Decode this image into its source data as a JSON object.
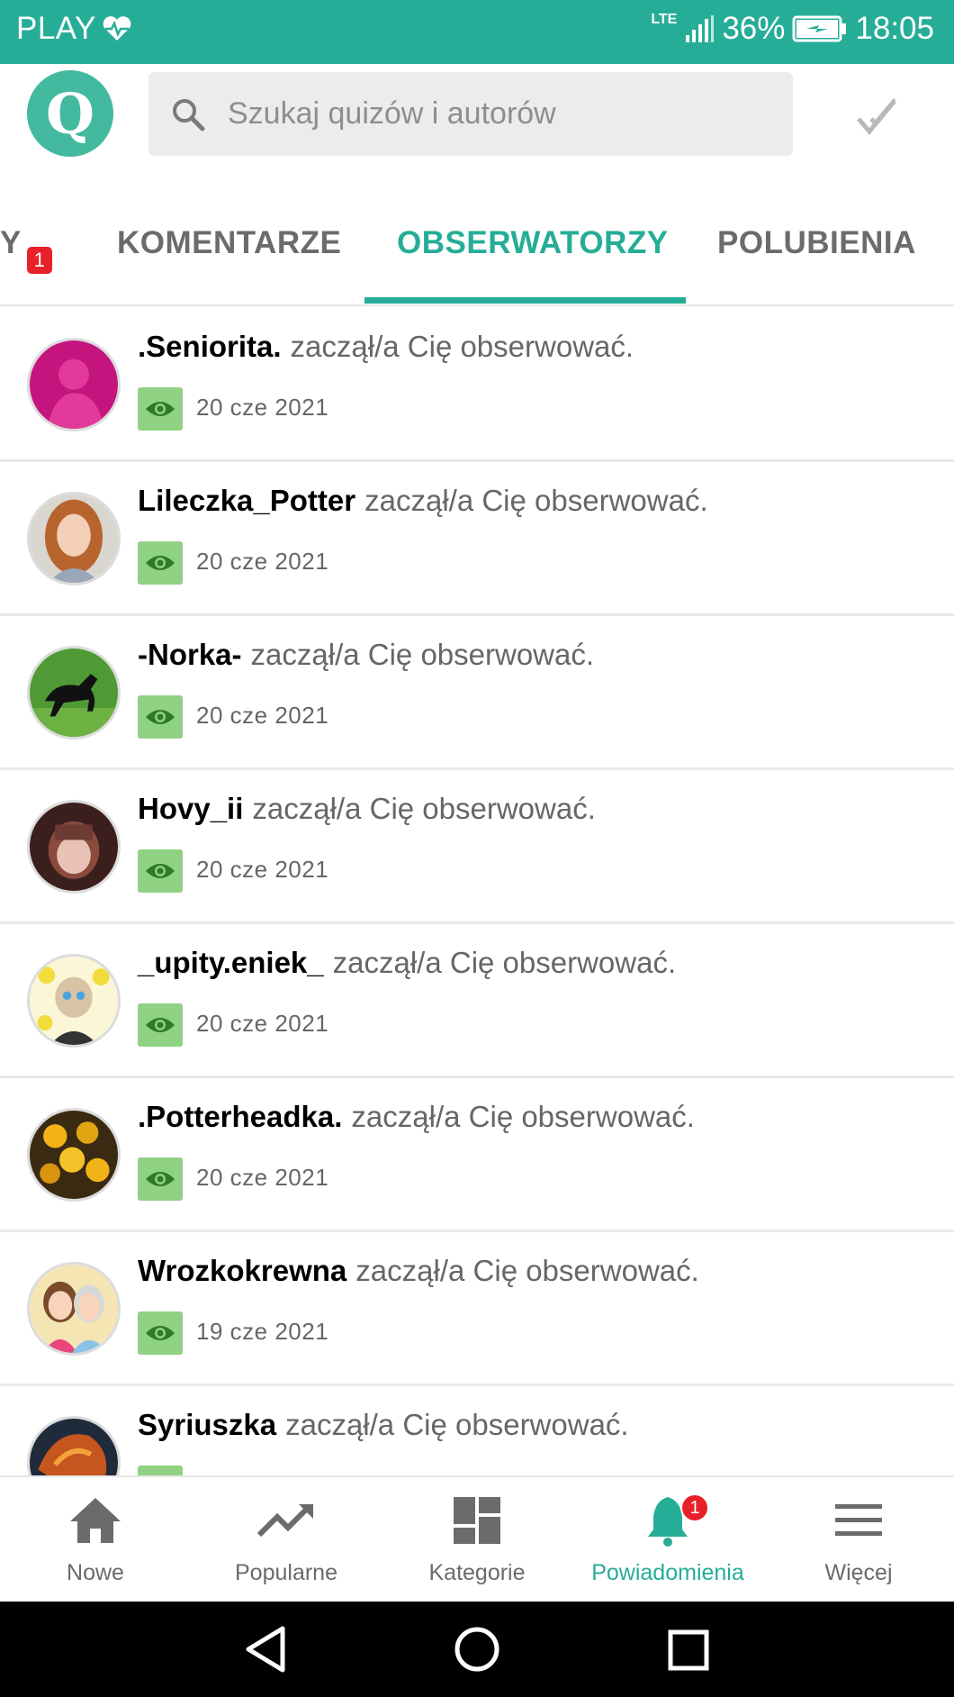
{
  "status_bar": {
    "carrier": "PLAY",
    "network": "LTE",
    "battery": "36%",
    "time": "18:05"
  },
  "header": {
    "logo_letter": "Q",
    "search_placeholder": "Szukaj quizów i autorów"
  },
  "tabs": [
    {
      "label": "Y",
      "badge": "1",
      "active": false
    },
    {
      "label": "KOMENTARZE",
      "active": false
    },
    {
      "label": "OBSERWATORZY",
      "active": true
    },
    {
      "label": "POLUBIENIA",
      "active": false
    }
  ],
  "notifications": [
    {
      "username": ".Seniorita.",
      "action": "zaczął/a Cię obserwować.",
      "date": "20 cze 2021",
      "avatar_color": "#c4157f"
    },
    {
      "username": "Lileczka_Potter",
      "action": "zaczął/a Cię obserwować.",
      "date": "20 cze 2021",
      "avatar_color": "#c8784f"
    },
    {
      "username": "-Norka-",
      "action": "zaczął/a Cię obserwować.",
      "date": "20 cze 2021",
      "avatar_color": "#3f8f2d"
    },
    {
      "username": "Hovy_ii",
      "action": "zaczął/a Cię obserwować.",
      "date": "20 cze 2021",
      "avatar_color": "#6b3b34"
    },
    {
      "username": "_upity.eniek_",
      "action": "zaczął/a Cię obserwować.",
      "date": "20 cze 2021",
      "avatar_color": "#f2dc3a"
    },
    {
      "username": ".Potterheadka.",
      "action": "zaczął/a Cię obserwować.",
      "date": "20 cze 2021",
      "avatar_color": "#e0a612"
    },
    {
      "username": "Wrozkokrewna",
      "action": "zaczął/a Cię obserwować.",
      "date": "19 cze 2021",
      "avatar_color": "#f4e5b3"
    },
    {
      "username": "Syriuszka",
      "action": "zaczął/a Cię obserwować.",
      "date": "",
      "avatar_color": "#c4561e"
    }
  ],
  "bottom_nav": [
    {
      "label": "Nowe",
      "icon": "home-icon",
      "active": false
    },
    {
      "label": "Popularne",
      "icon": "trending-icon",
      "active": false
    },
    {
      "label": "Kategorie",
      "icon": "dashboard-icon",
      "active": false
    },
    {
      "label": "Powiadomienia",
      "icon": "bell-icon",
      "active": true,
      "badge": "1"
    },
    {
      "label": "Więcej",
      "icon": "menu-icon",
      "active": false
    }
  ],
  "colors": {
    "accent": "#26ad97",
    "badge_red": "#e8202a",
    "eye_badge": "#8fd283"
  }
}
